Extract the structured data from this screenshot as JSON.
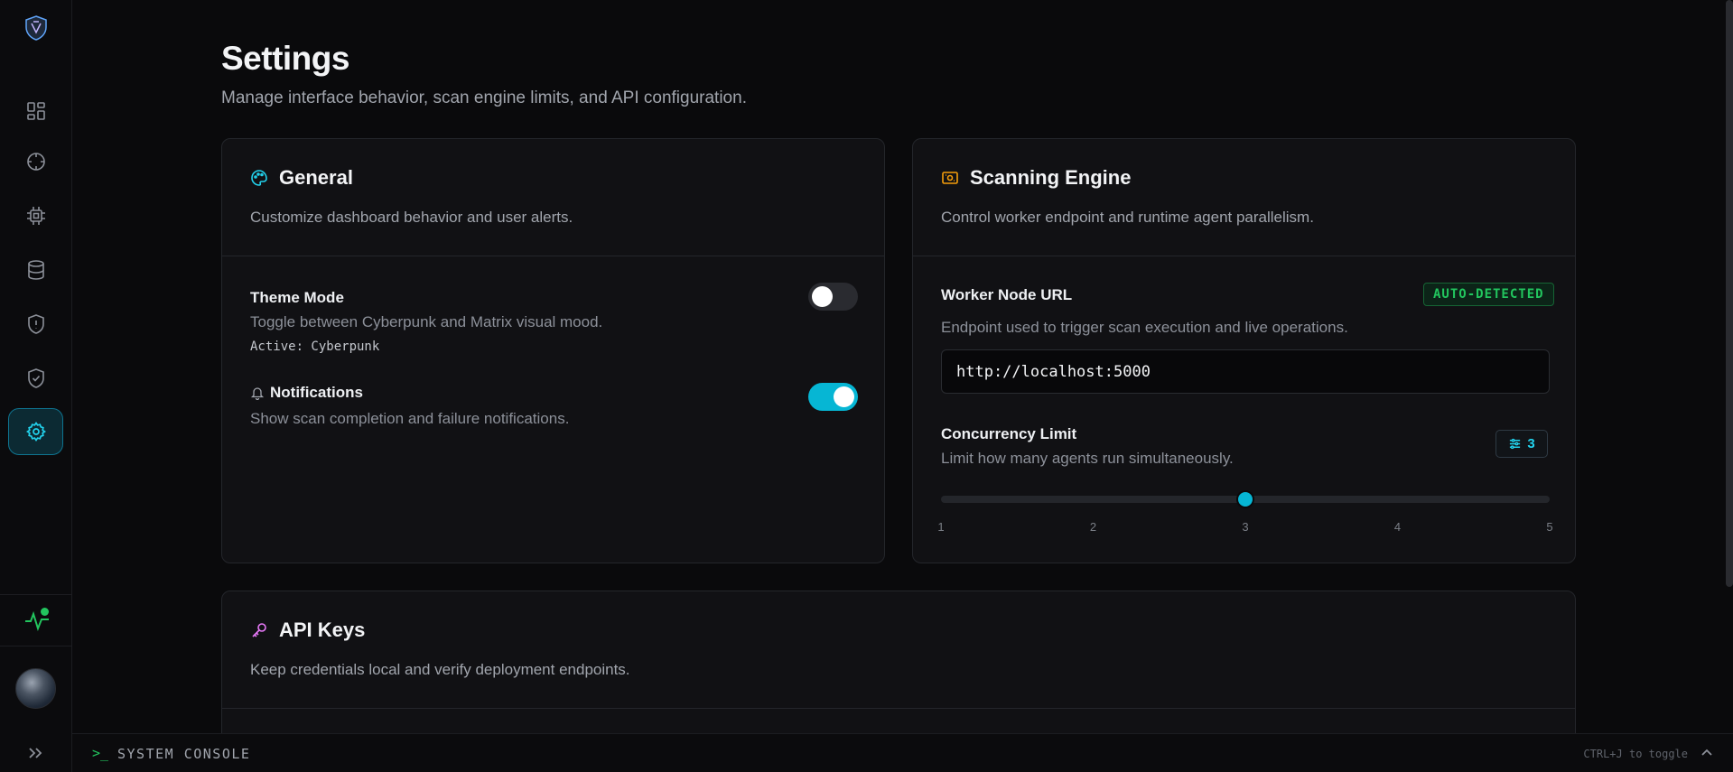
{
  "page": {
    "title": "Settings",
    "subtitle": "Manage interface behavior, scan engine limits, and API configuration."
  },
  "general": {
    "title": "General",
    "description": "Customize dashboard behavior and user alerts.",
    "theme_mode": {
      "label": "Theme Mode",
      "description": "Toggle between Cyberpunk and Matrix visual mood.",
      "active_text": "Active: Cyberpunk",
      "enabled": false
    },
    "notifications": {
      "label": "Notifications",
      "description": "Show scan completion and failure notifications.",
      "enabled": true
    }
  },
  "scanning": {
    "title": "Scanning Engine",
    "description": "Control worker endpoint and runtime agent parallelism.",
    "worker_url": {
      "label": "Worker Node URL",
      "badge": "AUTO-DETECTED",
      "description": "Endpoint used to trigger scan execution and live operations.",
      "value": "http://localhost:5000"
    },
    "concurrency": {
      "label": "Concurrency Limit",
      "description": "Limit how many agents run simultaneously.",
      "value": "3",
      "min": 1,
      "max": 5,
      "ticks": [
        "1",
        "2",
        "3",
        "4",
        "5"
      ]
    }
  },
  "api_keys": {
    "title": "API Keys",
    "description": "Keep credentials local and verify deployment endpoints."
  },
  "console": {
    "prompt": ">_",
    "label": "SYSTEM CONSOLE",
    "hint": "CTRL+J to toggle"
  },
  "colors": {
    "accent": "#06b6d4",
    "success": "#22c55e",
    "warning": "#f59e0b",
    "key_icon": "#e879f9"
  },
  "icons": {
    "sidebar": [
      "dashboard-icon",
      "target-icon",
      "chip-icon",
      "database-icon",
      "shield-alert-icon",
      "shield-check-icon",
      "settings-icon"
    ]
  }
}
